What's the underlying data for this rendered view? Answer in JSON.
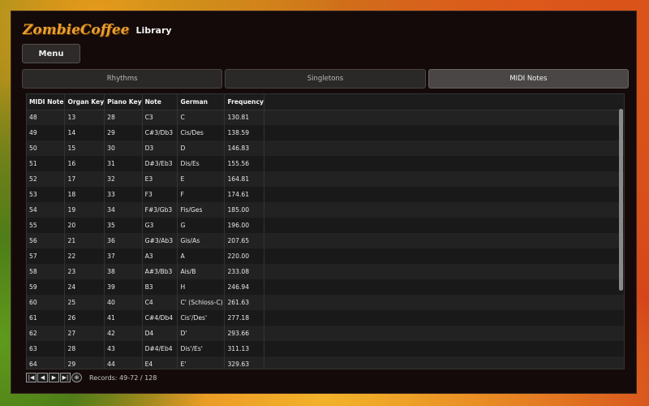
{
  "app": {
    "logo_text": "ZombieCoffee",
    "title": "Library"
  },
  "menu": {
    "label": "Menu"
  },
  "tabs": [
    {
      "label": "Rhythms",
      "active": false
    },
    {
      "label": "Singletons",
      "active": false
    },
    {
      "label": "MIDI Notes",
      "active": true
    }
  ],
  "table": {
    "columns": [
      "MIDI Note",
      "Organ Key",
      "Piano Key",
      "Note",
      "German",
      "Frequency"
    ],
    "rows": [
      [
        "48",
        "13",
        "28",
        "C3",
        "C",
        "130.81"
      ],
      [
        "49",
        "14",
        "29",
        "C#3/Db3",
        "Cis/Des",
        "138.59"
      ],
      [
        "50",
        "15",
        "30",
        "D3",
        "D",
        "146.83"
      ],
      [
        "51",
        "16",
        "31",
        "D#3/Eb3",
        "Dis/Es",
        "155.56"
      ],
      [
        "52",
        "17",
        "32",
        "E3",
        "E",
        "164.81"
      ],
      [
        "53",
        "18",
        "33",
        "F3",
        "F",
        "174.61"
      ],
      [
        "54",
        "19",
        "34",
        "F#3/Gb3",
        "Fis/Ges",
        "185.00"
      ],
      [
        "55",
        "20",
        "35",
        "G3",
        "G",
        "196.00"
      ],
      [
        "56",
        "21",
        "36",
        "G#3/Ab3",
        "Gis/As",
        "207.65"
      ],
      [
        "57",
        "22",
        "37",
        "A3",
        "A",
        "220.00"
      ],
      [
        "58",
        "23",
        "38",
        "A#3/Bb3",
        "Ais/B",
        "233.08"
      ],
      [
        "59",
        "24",
        "39",
        "B3",
        "H",
        "246.94"
      ],
      [
        "60",
        "25",
        "40",
        "C4",
        "C' (Schloss-C)",
        "261.63"
      ],
      [
        "61",
        "26",
        "41",
        "C#4/Db4",
        "Cis'/Des'",
        "277.18"
      ],
      [
        "62",
        "27",
        "42",
        "D4",
        "D'",
        "293.66"
      ],
      [
        "63",
        "28",
        "43",
        "D#4/Eb4",
        "Dis'/Es'",
        "311.13"
      ],
      [
        "64",
        "29",
        "44",
        "E4",
        "E'",
        "329.63"
      ]
    ]
  },
  "footer": {
    "buttons": [
      {
        "name": "first-page-icon",
        "glyph": "|◀"
      },
      {
        "name": "prev-page-icon",
        "glyph": "◀"
      },
      {
        "name": "next-page-icon",
        "glyph": "▶"
      },
      {
        "name": "last-page-icon",
        "glyph": "▶|"
      },
      {
        "name": "add-record-icon",
        "glyph": "⊕"
      }
    ],
    "records_text": "Records: 49-72 / 128"
  }
}
